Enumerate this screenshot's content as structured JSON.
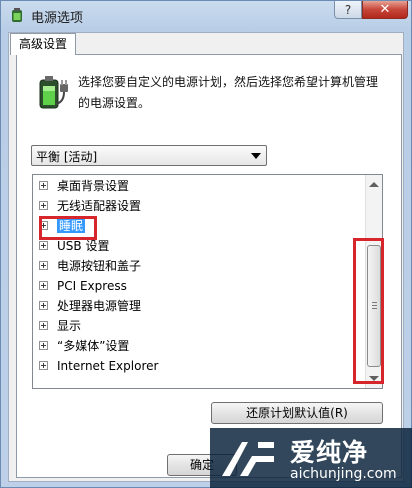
{
  "window": {
    "title": "电源选项",
    "help_label": "?",
    "close_label": "✕"
  },
  "tab": {
    "label": "高级设置"
  },
  "description": "选择您要自定义的电源计划，然后选择您希望计算机管理的电源设置。",
  "plan_select": {
    "value": "平衡 [活动]"
  },
  "tree_items": [
    {
      "label": "桌面背景设置"
    },
    {
      "label": "无线适配器设置"
    },
    {
      "label": "睡眠",
      "selected": true
    },
    {
      "label": "USB 设置"
    },
    {
      "label": "电源按钮和盖子"
    },
    {
      "label": "PCI Express"
    },
    {
      "label": "处理器电源管理"
    },
    {
      "label": "显示"
    },
    {
      "label": "“多媒体”设置"
    },
    {
      "label": "Internet Explorer"
    }
  ],
  "buttons": {
    "restore_defaults": "还原计划默认值(R)",
    "ok": "确定"
  },
  "watermark": {
    "name": "爱纯净",
    "url": "aichunjing.com"
  },
  "colors": {
    "highlight_box": "#d7262b",
    "selection": "#3399ff"
  },
  "icons": {
    "title": "power-options-icon",
    "panel": "battery-plug-icon"
  }
}
